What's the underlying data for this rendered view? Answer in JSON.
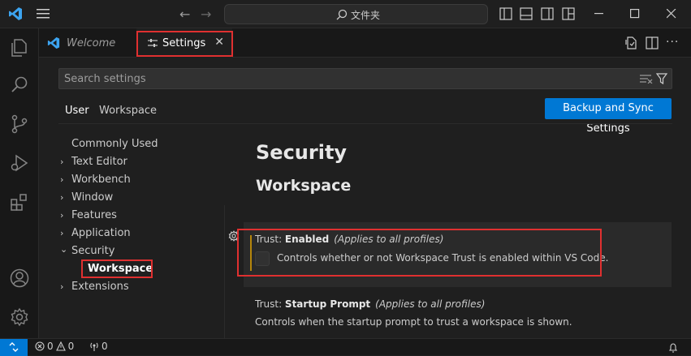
{
  "titlebar": {
    "search_text": "文件夹",
    "icons": [
      "vscode-logo-icon",
      "menu-icon",
      "back-arrow-icon",
      "forward-arrow-icon",
      "search-icon",
      "toggle-primary-sidebar-icon",
      "toggle-panel-icon",
      "toggle-secondary-sidebar-icon",
      "customize-layout-icon",
      "minimize-icon",
      "maximize-icon",
      "close-icon"
    ]
  },
  "activitybar": {
    "items": [
      "explorer-icon",
      "search-icon",
      "source-control-icon",
      "run-debug-icon",
      "extensions-icon"
    ],
    "bottom": [
      "accounts-icon",
      "manage-gear-icon"
    ]
  },
  "tabs": [
    {
      "label": "Welcome",
      "active": false
    },
    {
      "label": "Settings",
      "active": true,
      "close": "✕"
    }
  ],
  "settings": {
    "search_placeholder": "Search settings",
    "scopes": [
      "User",
      "Workspace"
    ],
    "sync_button": "Backup and Sync Settings",
    "toc": [
      {
        "label": "Commonly Used",
        "chevron": ""
      },
      {
        "label": "Text Editor",
        "chevron": "›"
      },
      {
        "label": "Workbench",
        "chevron": "›"
      },
      {
        "label": "Window",
        "chevron": "›"
      },
      {
        "label": "Features",
        "chevron": "›"
      },
      {
        "label": "Application",
        "chevron": "›"
      },
      {
        "label": "Security",
        "chevron": "⌄"
      },
      {
        "label": "Workspace",
        "chevron": ""
      },
      {
        "label": "Extensions",
        "chevron": "›"
      }
    ],
    "section_title": "Security",
    "subsection_title": "Workspace",
    "items": [
      {
        "prefix": "Trust: ",
        "name": "Enabled",
        "applies": "(Applies to all profiles)",
        "description": "Controls whether or not Workspace Trust is enabled within VS Code.",
        "checked": false
      },
      {
        "prefix": "Trust: ",
        "name": "Startup Prompt",
        "applies": "(Applies to all profiles)",
        "description": "Controls when the startup prompt to trust a workspace is shown."
      }
    ]
  },
  "statusbar": {
    "errors": "0",
    "warnings": "0",
    "ports": "0"
  },
  "colors": {
    "accent": "#0078d4",
    "highlight_box": "#e03030",
    "modified_indicator": "#b5860b"
  }
}
